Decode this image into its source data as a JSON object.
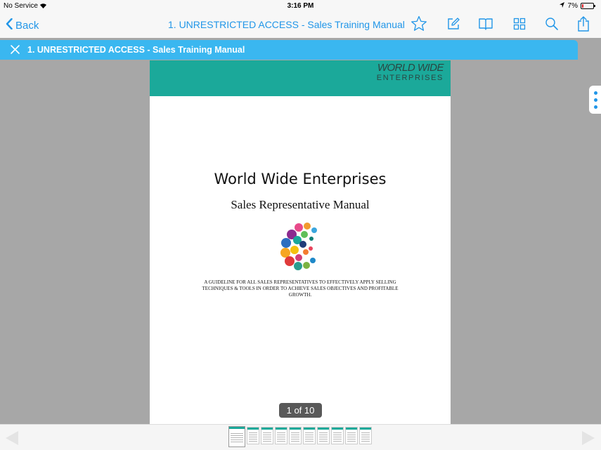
{
  "status_bar": {
    "carrier": "No Service",
    "time": "3:16 PM",
    "battery": "7%"
  },
  "nav": {
    "back_label": "Back",
    "title": "1. UNRESTRICTED ACCESS - Sales Training Manual",
    "tools": [
      "star-icon",
      "edit-icon",
      "book-icon",
      "grid-icon",
      "search-icon",
      "share-icon"
    ]
  },
  "tab": {
    "label": "1. UNRESTRICTED ACCESS - Sales Training Manual"
  },
  "document": {
    "logo_line1": "WORLD WIDE",
    "logo_line2": "ENTERPRISES",
    "title": "World Wide Enterprises",
    "subtitle": "Sales Representative Manual",
    "blurb": "A GUIDELINE FOR ALL SALES REPRESENTATIVES TO EFFECTIVELY APPLY SELLING TECHNIQUES & TOOLS IN ORDER TO ACHIEVE SALES OBJECTIVES AND PROFITABLE GROWTH."
  },
  "page_counter": "1 of 10",
  "thumbnails": {
    "count": 10,
    "current": 1
  },
  "colors": {
    "accent": "#2196e8",
    "tab_strip": "#3ab7f0",
    "banner": "#1ba99a"
  }
}
